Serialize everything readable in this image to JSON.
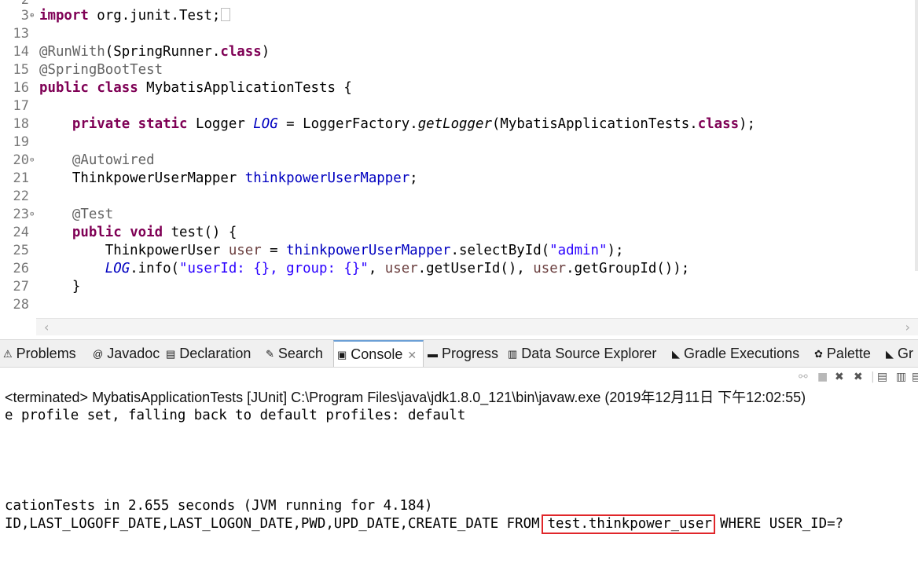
{
  "editor": {
    "partial_top_line_number": "2",
    "lines": [
      {
        "num": "3",
        "fold": "+",
        "tokens": [
          {
            "t": "import",
            "c": "kw"
          },
          {
            "t": " org.junit.Test;",
            "c": ""
          }
        ],
        "collapsed": true
      },
      {
        "num": "13",
        "fold": "",
        "tokens": []
      },
      {
        "num": "14",
        "fold": "",
        "tokens": [
          {
            "t": "@RunWith",
            "c": "an"
          },
          {
            "t": "(SpringRunner.",
            "c": ""
          },
          {
            "t": "class",
            "c": "kw"
          },
          {
            "t": ")",
            "c": ""
          }
        ]
      },
      {
        "num": "15",
        "fold": "",
        "tokens": [
          {
            "t": "@SpringBootTest",
            "c": "an"
          }
        ]
      },
      {
        "num": "16",
        "fold": "",
        "tokens": [
          {
            "t": "public",
            "c": "kw"
          },
          {
            "t": " ",
            "c": ""
          },
          {
            "t": "class",
            "c": "kw"
          },
          {
            "t": " MybatisApplicationTests {",
            "c": ""
          }
        ]
      },
      {
        "num": "17",
        "fold": "",
        "tokens": []
      },
      {
        "num": "18",
        "fold": "",
        "tokens": [
          {
            "t": "    ",
            "c": ""
          },
          {
            "t": "private",
            "c": "kw"
          },
          {
            "t": " ",
            "c": ""
          },
          {
            "t": "static",
            "c": "kw"
          },
          {
            "t": " Logger ",
            "c": ""
          },
          {
            "t": "LOG",
            "c": "sfld"
          },
          {
            "t": " = LoggerFactory.",
            "c": ""
          },
          {
            "t": "getLogger",
            "c": "it"
          },
          {
            "t": "(MybatisApplicationTests.",
            "c": ""
          },
          {
            "t": "class",
            "c": "kw"
          },
          {
            "t": ");",
            "c": ""
          }
        ]
      },
      {
        "num": "19",
        "fold": "",
        "tokens": []
      },
      {
        "num": "20",
        "fold": "-",
        "tokens": [
          {
            "t": "    ",
            "c": ""
          },
          {
            "t": "@Autowired",
            "c": "an"
          }
        ]
      },
      {
        "num": "21",
        "fold": "",
        "tokens": [
          {
            "t": "    ThinkpowerUserMapper ",
            "c": ""
          },
          {
            "t": "thinkpowerUserMapper",
            "c": "fld"
          },
          {
            "t": ";",
            "c": ""
          }
        ]
      },
      {
        "num": "22",
        "fold": "",
        "tokens": []
      },
      {
        "num": "23",
        "fold": "-",
        "tokens": [
          {
            "t": "    ",
            "c": ""
          },
          {
            "t": "@Test",
            "c": "an"
          }
        ]
      },
      {
        "num": "24",
        "fold": "",
        "tokens": [
          {
            "t": "    ",
            "c": ""
          },
          {
            "t": "public",
            "c": "kw"
          },
          {
            "t": " ",
            "c": ""
          },
          {
            "t": "void",
            "c": "kw"
          },
          {
            "t": " test() {",
            "c": ""
          }
        ]
      },
      {
        "num": "25",
        "fold": "",
        "tokens": [
          {
            "t": "        ThinkpowerUser ",
            "c": ""
          },
          {
            "t": "user",
            "c": "loc"
          },
          {
            "t": " = ",
            "c": ""
          },
          {
            "t": "thinkpowerUserMapper",
            "c": "fld"
          },
          {
            "t": ".selectById(",
            "c": ""
          },
          {
            "t": "\"admin\"",
            "c": "str"
          },
          {
            "t": ");",
            "c": ""
          }
        ]
      },
      {
        "num": "26",
        "fold": "",
        "tokens": [
          {
            "t": "        ",
            "c": ""
          },
          {
            "t": "LOG",
            "c": "sfld"
          },
          {
            "t": ".info(",
            "c": ""
          },
          {
            "t": "\"userId: {}, group: {}\"",
            "c": "str"
          },
          {
            "t": ", ",
            "c": ""
          },
          {
            "t": "user",
            "c": "loc"
          },
          {
            "t": ".getUserId(), ",
            "c": ""
          },
          {
            "t": "user",
            "c": "loc"
          },
          {
            "t": ".getGroupId());",
            "c": ""
          }
        ]
      },
      {
        "num": "27",
        "fold": "",
        "tokens": [
          {
            "t": "    }",
            "c": ""
          }
        ]
      },
      {
        "num": "28",
        "fold": "",
        "tokens": []
      }
    ]
  },
  "tabs": [
    {
      "label": "Problems",
      "icon": "problems-icon",
      "glyph": "⚠",
      "active": false
    },
    {
      "label": "Javadoc",
      "icon": "javadoc-icon",
      "glyph": "@",
      "active": false
    },
    {
      "label": "Declaration",
      "icon": "declaration-icon",
      "glyph": "▤",
      "active": false
    },
    {
      "label": "Search",
      "icon": "search-icon",
      "glyph": "✎",
      "active": false
    },
    {
      "label": "Console",
      "icon": "console-icon",
      "glyph": "▣",
      "active": true
    },
    {
      "label": "Progress",
      "icon": "progress-icon",
      "glyph": "▬",
      "active": false
    },
    {
      "label": "Data Source Explorer",
      "icon": "data-source-icon",
      "glyph": "▥",
      "active": false
    },
    {
      "label": "Gradle Executions",
      "icon": "gradle-icon",
      "glyph": "◣",
      "active": false
    },
    {
      "label": "Palette",
      "icon": "palette-icon",
      "glyph": "✿",
      "active": false
    },
    {
      "label": "Gr",
      "icon": "gradle-icon",
      "glyph": "◣",
      "active": false
    }
  ],
  "console": {
    "terminated_label": "<terminated> MybatisApplicationTests [JUnit] C:\\Program Files\\java\\jdk1.8.0_121\\bin\\javaw.exe (2019年12月11日 下午12:02:55)",
    "line1": "e profile set, falling back to default profiles: default",
    "line2": "cationTests in 2.655 seconds (JVM running for 4.184)",
    "line3_before": "ID,LAST_LOGOFF_DATE,LAST_LOGON_DATE,PWD,UPD_DATE,CREATE_DATE FROM",
    "line3_highlight": "test.thinkpower_user",
    "line3_after": "WHERE USER_ID=?"
  },
  "colors": {
    "keyword": "#7f0055",
    "annotation": "#646464",
    "field": "#0000c0",
    "string": "#2a00ff",
    "highlight_box": "#e0262a"
  }
}
